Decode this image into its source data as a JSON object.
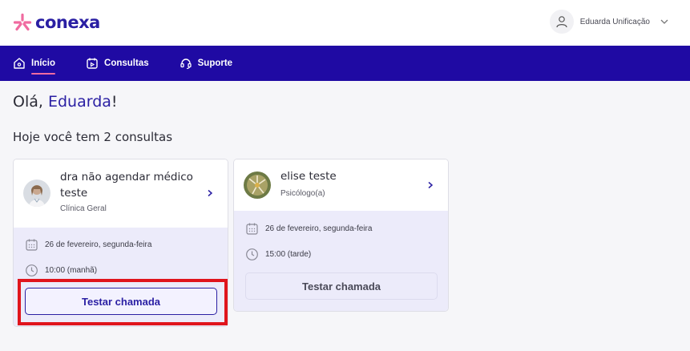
{
  "brand": {
    "name": "conexa",
    "accent": "#2a1fa3",
    "logo_color": "#f06ba0"
  },
  "user": {
    "name": "Eduarda Unificação"
  },
  "nav": {
    "bg": "#1f0aa3",
    "items": [
      {
        "label": "Início",
        "icon": "home-icon",
        "active": true
      },
      {
        "label": "Consultas",
        "icon": "calendar-play-icon"
      },
      {
        "label": "Suporte",
        "icon": "headset-icon"
      }
    ]
  },
  "greeting": {
    "prefix": "Olá, ",
    "name": "Eduarda",
    "suffix": "!"
  },
  "subtitle": "Hoje você tem 2 consultas",
  "consultations": [
    {
      "doctor": "dra não agendar médico teste",
      "specialty": "Clínica Geral",
      "date": "26 de fevereiro, segunda-feira",
      "time": "10:00 (manhã)",
      "button": "Testar chamada"
    },
    {
      "doctor": "elise teste",
      "specialty": "Psicólogo(a)",
      "date": "26 de fevereiro, segunda-feira",
      "time": "15:00 (tarde)",
      "button": "Testar chamada"
    }
  ]
}
